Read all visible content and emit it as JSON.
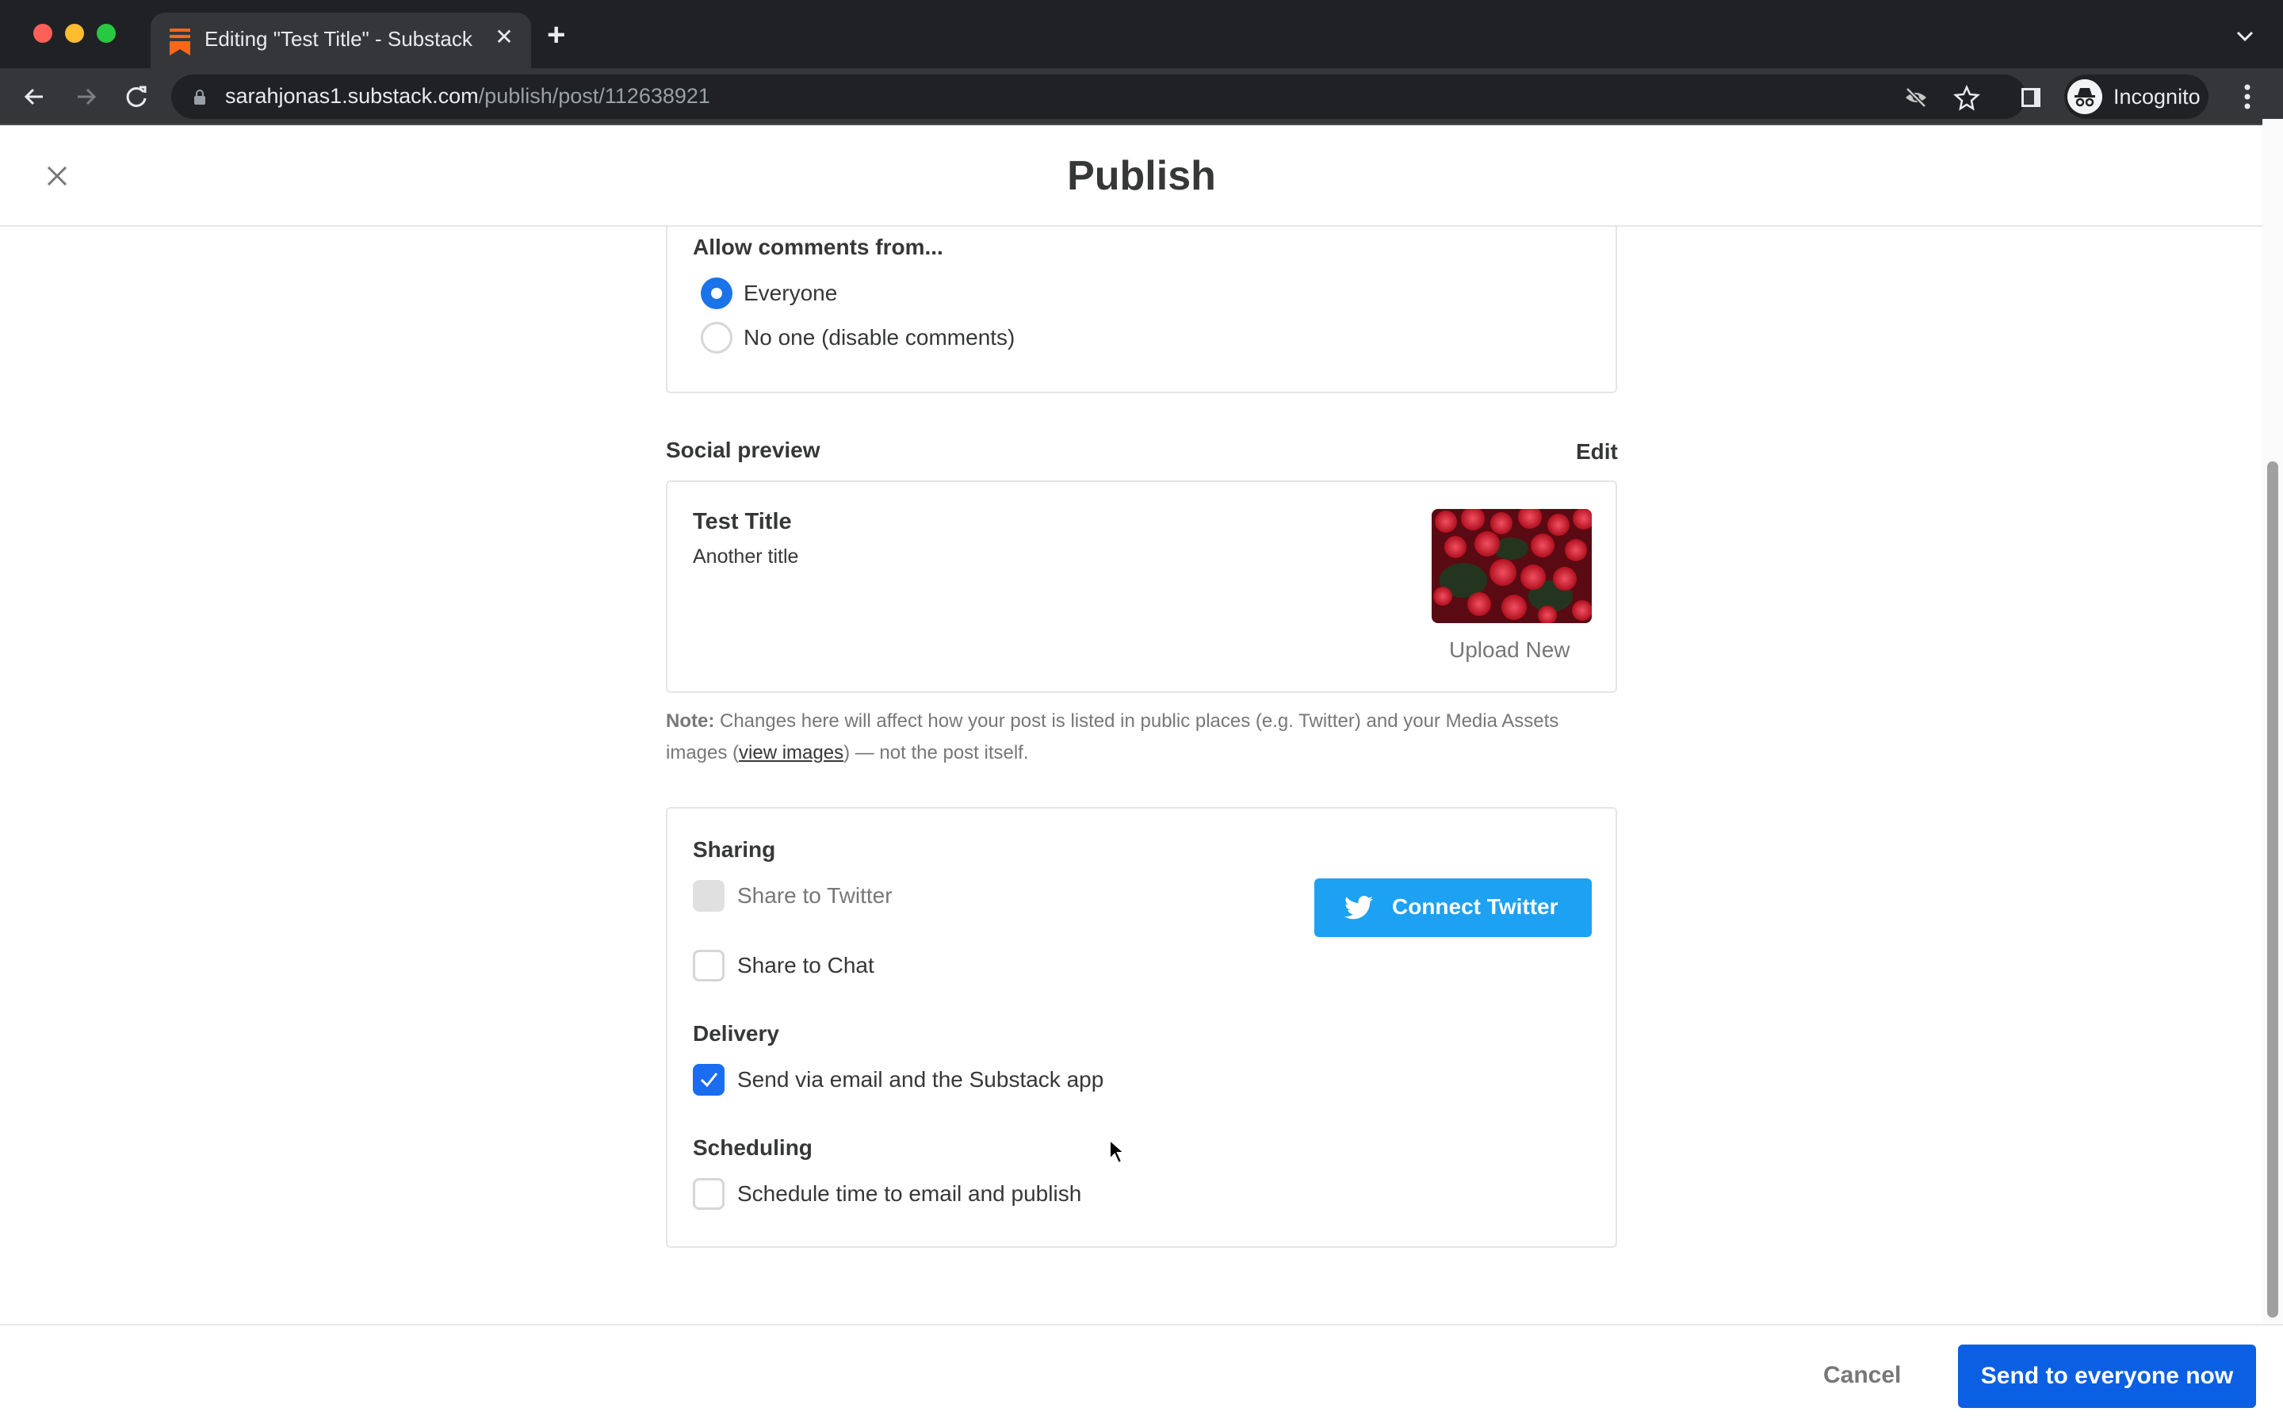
{
  "browser": {
    "tab_title": "Editing \"Test Title\" - Substack",
    "url_host": "sarahjonas1.substack.com",
    "url_path": "/publish/post/112638921",
    "profile_label": "Incognito"
  },
  "header": {
    "title": "Publish"
  },
  "comments": {
    "label": "Allow comments from...",
    "options": [
      {
        "label": "Everyone",
        "selected": true
      },
      {
        "label": "No one (disable comments)",
        "selected": false
      }
    ]
  },
  "social_preview": {
    "label": "Social preview",
    "edit_label": "Edit",
    "title": "Test Title",
    "subtitle": "Another title",
    "image_alt": "red flowers",
    "upload_label": "Upload New",
    "note_bold": "Note:",
    "note_text_1": " Changes here will affect how your post is listed in public places (e.g. Twitter) and your Media Assets images (",
    "note_link": "view images",
    "note_text_2": ") — not the post itself."
  },
  "sharing": {
    "label": "Sharing",
    "share_twitter": {
      "label": "Share to Twitter",
      "checked": false,
      "disabled": true
    },
    "share_chat": {
      "label": "Share to Chat",
      "checked": false
    },
    "connect_twitter_label": "Connect Twitter"
  },
  "delivery": {
    "label": "Delivery",
    "send_email": {
      "label": "Send via email and the Substack app",
      "checked": true
    }
  },
  "scheduling": {
    "label": "Scheduling",
    "schedule": {
      "label": "Schedule time to email and publish",
      "checked": false
    }
  },
  "footer": {
    "cancel_label": "Cancel",
    "send_label": "Send to everyone now"
  },
  "colors": {
    "accent_blue": "#0b5fe3",
    "twitter_blue": "#1da1f2",
    "substack_orange": "#ff6719"
  }
}
